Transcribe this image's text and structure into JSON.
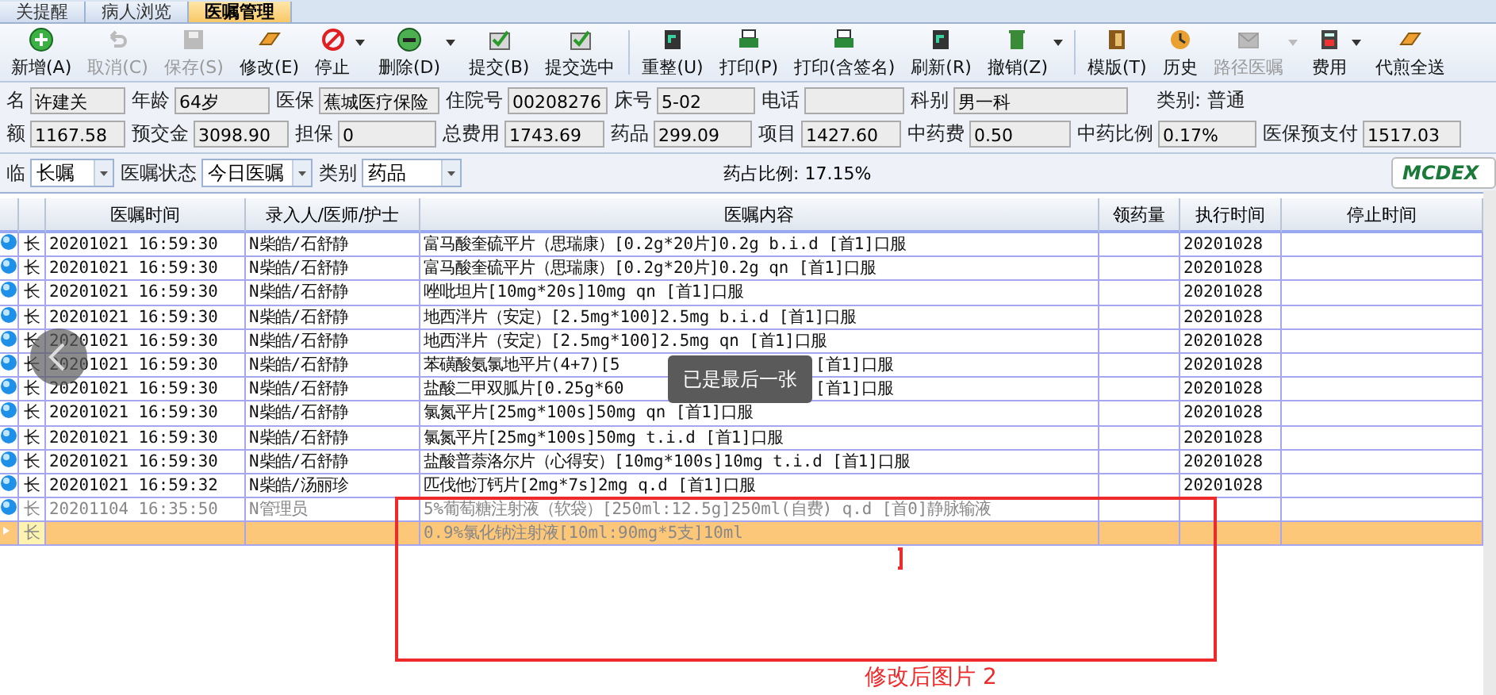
{
  "tabs": [
    {
      "label": "关提醒",
      "selected": false
    },
    {
      "label": "病人浏览",
      "selected": false
    },
    {
      "label": "医嘱管理",
      "selected": true
    }
  ],
  "toolbar": [
    {
      "label": "新增(A)",
      "kind": "add",
      "disabled": false,
      "dropdown": false
    },
    {
      "label": "取消(C)",
      "kind": "undo",
      "disabled": true,
      "dropdown": false
    },
    {
      "label": "保存(S)",
      "kind": "save",
      "disabled": true,
      "dropdown": false
    },
    {
      "label": "修改(E)",
      "kind": "eraser",
      "disabled": false,
      "dropdown": false
    },
    {
      "label": "停止",
      "kind": "stop",
      "disabled": false,
      "dropdown": true
    },
    {
      "label": "删除(D)",
      "kind": "minus",
      "disabled": false,
      "dropdown": true
    },
    {
      "label": "提交(B)",
      "kind": "check",
      "disabled": false,
      "dropdown": false
    },
    {
      "label": "提交选中",
      "kind": "check",
      "disabled": false,
      "dropdown": false
    },
    {
      "label": "重整(U)",
      "kind": "doc",
      "disabled": false,
      "dropdown": false,
      "separator": true
    },
    {
      "label": "打印(P)",
      "kind": "print",
      "disabled": false,
      "dropdown": false
    },
    {
      "label": "打印(含签名)",
      "kind": "print",
      "disabled": false,
      "dropdown": false
    },
    {
      "label": "刷新(R)",
      "kind": "doc",
      "disabled": false,
      "dropdown": false
    },
    {
      "label": "撤销(Z)",
      "kind": "trash",
      "disabled": false,
      "dropdown": true
    },
    {
      "label": "模版(T)",
      "kind": "book",
      "disabled": false,
      "dropdown": false,
      "separator": true
    },
    {
      "label": "历史",
      "kind": "history",
      "disabled": false,
      "dropdown": false
    },
    {
      "label": "路径医嘱",
      "kind": "mail",
      "disabled": true,
      "dropdown": true
    },
    {
      "label": "费用",
      "kind": "calc",
      "disabled": false,
      "dropdown": true
    },
    {
      "label": "代煎全送",
      "kind": "eraser",
      "disabled": false,
      "dropdown": false
    }
  ],
  "patient_rows": [
    [
      {
        "label": "名",
        "value": "许建关"
      },
      {
        "label": "年龄",
        "value": "64岁"
      },
      {
        "label": "医保",
        "value": "蕉城医疗保险"
      },
      {
        "label": "住院号",
        "value": "00208276"
      },
      {
        "label": "床号",
        "value": "5-02"
      },
      {
        "label": "电话"
      },
      {
        "label": "科别",
        "value": "男一科"
      },
      {
        "text": "类别: 普通"
      }
    ],
    [
      {
        "label": "额",
        "value": "1167.58"
      },
      {
        "label": "预交金",
        "value": "3098.90"
      },
      {
        "label": "担保",
        "value": "0"
      },
      {
        "label": "总费用",
        "value": "1743.69"
      },
      {
        "label": "药品",
        "value": "299.09"
      },
      {
        "label": "项目",
        "value": "1427.60"
      },
      {
        "label": "中药费",
        "value": "0.50"
      },
      {
        "label": "中药比例",
        "value": "0.17%"
      },
      {
        "label": "医保预支付",
        "value": "1517.03"
      }
    ]
  ],
  "filters": [
    {
      "label": "临",
      "value": "长嘱"
    },
    {
      "label": "医嘱状态",
      "value": "今日医嘱"
    },
    {
      "label": "类别",
      "value": "药品"
    }
  ],
  "drug_ratio": "药占比例: 17.15%",
  "logo": "MCDEX",
  "table": {
    "columns": [
      "医嘱时间",
      "录入人/医师/护士",
      "医嘱内容",
      "领药量",
      "执行时间",
      "停止时间"
    ],
    "rows": [
      {
        "type": "长",
        "time": "20201021 16:59:30",
        "recorder": "N柴皓/石舒静",
        "content": "富马酸奎硫平片（思瑞康）[0.2g*20片]0.2g b.i.d [首1]口服",
        "exec": "20201028",
        "submitted": true,
        "selected": false
      },
      {
        "type": "长",
        "time": "20201021 16:59:30",
        "recorder": "N柴皓/石舒静",
        "content": "富马酸奎硫平片（思瑞康）[0.2g*20片]0.2g qn [首1]口服",
        "exec": "20201028",
        "submitted": true,
        "selected": false
      },
      {
        "type": "长",
        "time": "20201021 16:59:30",
        "recorder": "N柴皓/石舒静",
        "content": "唑吡坦片[10mg*20s]10mg qn [首1]口服",
        "exec": "20201028",
        "submitted": true,
        "selected": false
      },
      {
        "type": "长",
        "time": "20201021 16:59:30",
        "recorder": "N柴皓/石舒静",
        "content": "地西泮片（安定）[2.5mg*100]2.5mg b.i.d [首1]口服",
        "exec": "20201028",
        "submitted": true,
        "selected": false
      },
      {
        "type": "长",
        "time": "20201021 16:59:30",
        "recorder": "N柴皓/石舒静",
        "content": "地西泮片（安定）[2.5mg*100]2.5mg qn [首1]口服",
        "exec": "20201028",
        "submitted": true,
        "selected": false
      },
      {
        "type": "长",
        "time": "20201021 16:59:30",
        "recorder": "N柴皓/石舒静",
        "content": "苯磺酸氨氯地平片(4+7)[5",
        "content_tail": "[首1]口服",
        "exec": "20201028",
        "submitted": true,
        "selected": false
      },
      {
        "type": "长",
        "time": "20201021 16:59:30",
        "recorder": "N柴皓/石舒静",
        "content": "盐酸二甲双胍片[0.25g*60",
        "content_tail": "[首1]口服",
        "exec": "20201028",
        "submitted": true,
        "selected": false
      },
      {
        "type": "长",
        "time": "20201021 16:59:30",
        "recorder": "N柴皓/石舒静",
        "content": "氯氮平片[25mg*100s]50mg qn [首1]口服",
        "exec": "20201028",
        "submitted": true,
        "selected": false
      },
      {
        "type": "长",
        "time": "20201021 16:59:30",
        "recorder": "N柴皓/石舒静",
        "content": "氯氮平片[25mg*100s]50mg t.i.d [首1]口服",
        "exec": "20201028",
        "submitted": true,
        "selected": false
      },
      {
        "type": "长",
        "time": "20201021 16:59:30",
        "recorder": "N柴皓/石舒静",
        "content": "盐酸普萘洛尔片（心得安）[10mg*100s]10mg t.i.d [首1]口服",
        "exec": "20201028",
        "submitted": true,
        "selected": false
      },
      {
        "type": "长",
        "time": "20201021 16:59:32",
        "recorder": "N柴皓/汤丽珍",
        "content": "匹伐他汀钙片[2mg*7s]2mg q.d [首1]口服",
        "exec": "20201028",
        "submitted": true,
        "selected": false
      },
      {
        "type": "长",
        "time": "20201104 16:35:50",
        "recorder": "N管理员",
        "content": "5%葡萄糖注射液（软袋）[250ml:12.5g]250ml(自费) q.d [首0]静脉输液",
        "submitted": false,
        "selected": false
      },
      {
        "type": "长",
        "content": "0.9%氯化钠注射液[10ml:90mg*5支]10ml",
        "submitted": false,
        "selected": true
      }
    ]
  },
  "toast": "已是最后一张",
  "annotation": "修改后图片 2"
}
